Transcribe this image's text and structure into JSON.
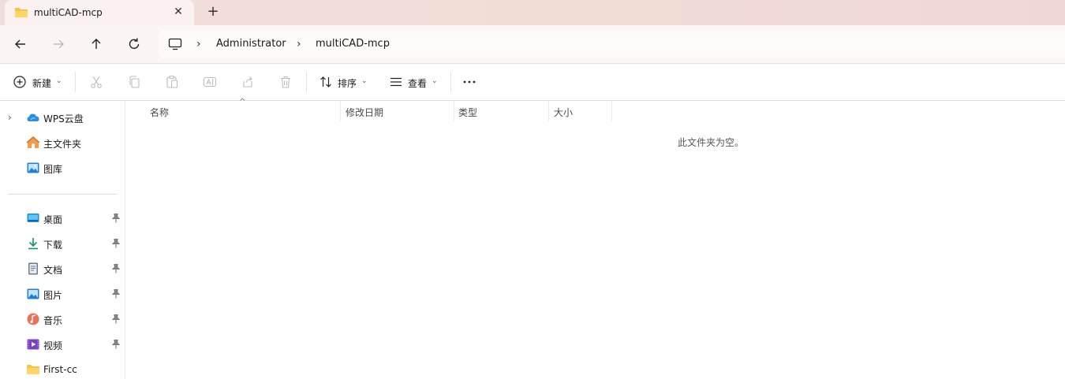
{
  "tab": {
    "title": "multiCAD-mcp",
    "close_icon": "close-icon",
    "new_tab_icon": "plus-icon"
  },
  "nav": {
    "back_icon": "arrow-left-icon",
    "forward_icon": "arrow-right-icon",
    "up_icon": "arrow-up-icon",
    "refresh_icon": "refresh-icon"
  },
  "address": {
    "pc_icon": "monitor-icon",
    "crumbs": [
      "Administrator",
      "multiCAD-mcp"
    ]
  },
  "toolbar": {
    "new_label": "新建",
    "sort_label": "排序",
    "view_label": "查看",
    "more_label": "···"
  },
  "sidebar": {
    "top_items": [
      {
        "label": "WPS云盘",
        "icon": "cloud-icon"
      },
      {
        "label": "主文件夹",
        "icon": "home-icon"
      },
      {
        "label": "图库",
        "icon": "gallery-icon"
      }
    ],
    "pinned_items": [
      {
        "label": "桌面",
        "icon": "desktop-icon"
      },
      {
        "label": "下载",
        "icon": "download-icon"
      },
      {
        "label": "文档",
        "icon": "document-icon"
      },
      {
        "label": "图片",
        "icon": "pictures-icon"
      },
      {
        "label": "音乐",
        "icon": "music-icon"
      },
      {
        "label": "视频",
        "icon": "video-icon"
      },
      {
        "label": "First-cc",
        "icon": "folder-icon"
      }
    ]
  },
  "content": {
    "columns": [
      "名称",
      "修改日期",
      "类型",
      "大小"
    ],
    "empty_message": "此文件夹为空。"
  },
  "colors": {
    "accent": "#0067c0",
    "folder": "#f5c542",
    "titlebar": "#f1dddd"
  }
}
